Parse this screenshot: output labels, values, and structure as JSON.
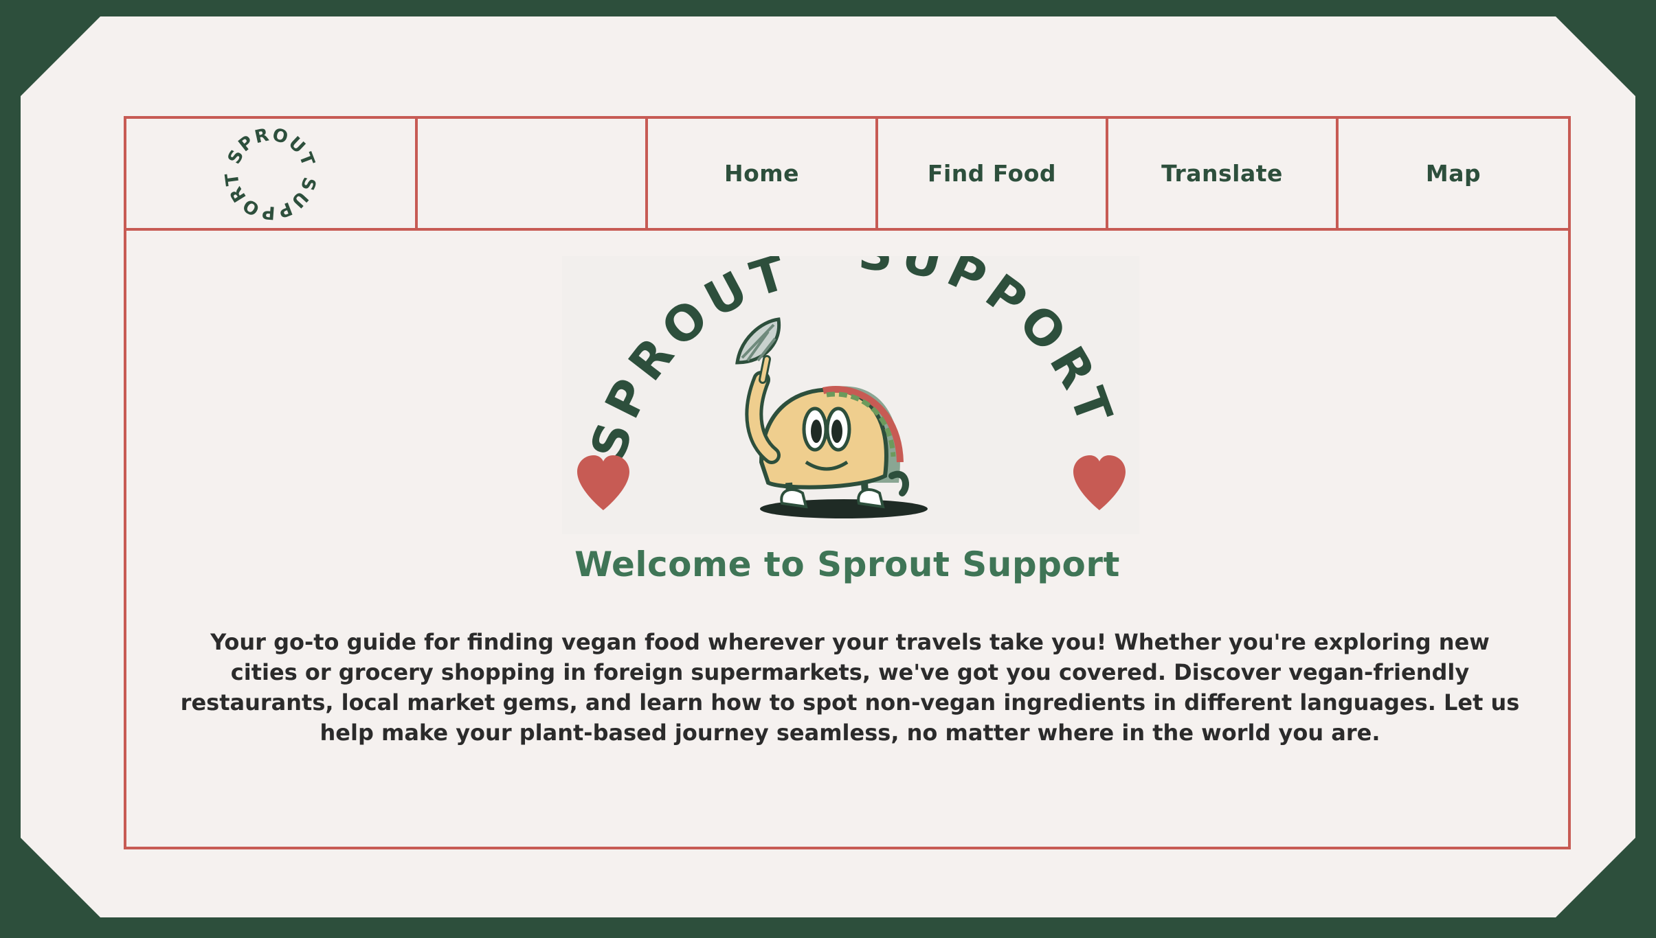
{
  "brand": {
    "logo_text": "SPROUT SUPPORT",
    "colors": {
      "dark_green": "#2d4f3c",
      "accent_red": "#c75b54",
      "heading_green": "#3f7556",
      "background": "#f5f1ef"
    }
  },
  "nav": {
    "items": [
      {
        "label": "Home"
      },
      {
        "label": "Find Food"
      },
      {
        "label": "Translate"
      },
      {
        "label": "Map"
      }
    ]
  },
  "hero": {
    "arc_left": "SPROUT",
    "arc_right": "SUPPORT",
    "mascot": "taco-mascot-icon"
  },
  "main": {
    "title": "Welcome to Sprout Support",
    "description": "Your go-to guide for finding vegan food wherever your travels take you! Whether you're exploring new cities or grocery shopping in foreign supermarkets, we've got you covered. Discover vegan-friendly restaurants, local market gems, and learn how to spot non-vegan ingredients in different languages. Let us help make your plant-based journey seamless, no matter where in the world you are."
  }
}
